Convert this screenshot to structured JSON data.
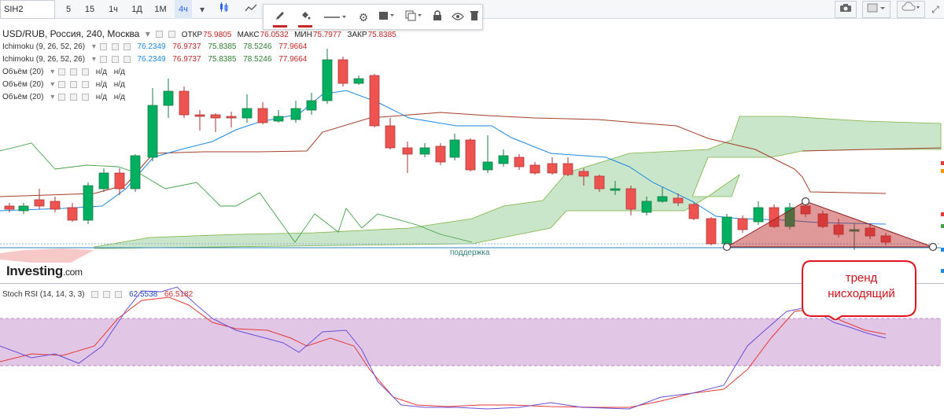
{
  "toolbar": {
    "symbol": "SIH2",
    "intervals": [
      "5",
      "15",
      "1ч",
      "1Д",
      "1М",
      "4ч"
    ],
    "active_interval": "4ч"
  },
  "drawing_toolbar": {
    "tools": [
      "pencil-icon",
      "fill-icon",
      "line-style-icon",
      "settings-icon",
      "template-icon",
      "clone-icon",
      "lock-icon",
      "eye-icon",
      "trash-icon"
    ],
    "accent": "#c62828"
  },
  "main_chart": {
    "title": "USD/RUB, Россия, 240, Москва",
    "open_label": "ОТКР",
    "open": "75.9805",
    "high_label": "МАКС",
    "high": "76.0532",
    "low_label": "МИН",
    "low": "75.7977",
    "close_label": "ЗАКР",
    "close": "75.8385"
  },
  "indicators": [
    {
      "name": "Ichimoku (9, 26, 52, 26)",
      "v1": "76.2349",
      "v2": "76.9737",
      "v3": "75.8385",
      "v4": "78.5246",
      "v5": "77.9664"
    },
    {
      "name": "Ichimoku (9, 26, 52, 26)",
      "v1": "76.2349",
      "v2": "76.9737",
      "v3": "75.8385",
      "v4": "78.5246",
      "v5": "77.9664"
    },
    {
      "name": "Объём (20)",
      "v1": "н/д",
      "v2": "н/д"
    },
    {
      "name": "Объём (20)",
      "v1": "н/д",
      "v2": "н/д"
    },
    {
      "name": "Объём (20)",
      "v1": "н/д",
      "v2": "н/д"
    }
  ],
  "annotations": {
    "support": "поддержка",
    "callout_line1": "тренд",
    "callout_line2": "нисходящий"
  },
  "brand": {
    "name": "Investing",
    "suffix": ".com"
  },
  "stoch_rsi": {
    "name": "Stoch RSI (14, 14, 3, 3)",
    "k": "62.5538",
    "d": "66.5182"
  },
  "colors": {
    "up": "#00b060",
    "down": "#ef5350",
    "tenkan": "#1e88e5",
    "kijun": "#a63d2a",
    "chikou": "#43a047",
    "cloud_up": "#a5d6a7",
    "cloud_down": "#ef9a9a",
    "rsi_k": "#6a4fd8",
    "rsi_d": "#e53935",
    "rsi_band": "#e1c6e6",
    "callout": "#e0141e"
  }
}
